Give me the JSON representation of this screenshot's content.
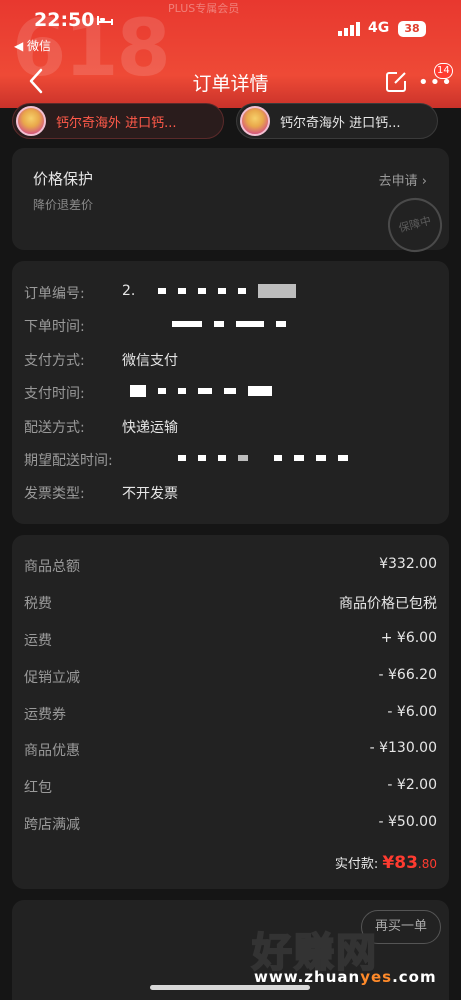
{
  "status_bar": {
    "time": "22:50",
    "back_app": "◀ 微信",
    "network": "4G",
    "battery": "38"
  },
  "header": {
    "background_text": "618",
    "faded_top_text": "PLUS专属会员",
    "title": "订单详情",
    "more_badge": "14"
  },
  "products": [
    {
      "name": "钙尔奇海外 进口钙..."
    },
    {
      "name": "钙尔奇海外 进口钙..."
    }
  ],
  "price_protection": {
    "title": "价格保护",
    "subtitle": "降价退差价",
    "link": "去申请 ›",
    "stamp": "保障中"
  },
  "order_info": {
    "order_no_label": "订单编号:",
    "order_no_prefix": "2.",
    "order_time_label": "下单时间:",
    "payment_method_label": "支付方式:",
    "payment_method": "微信支付",
    "payment_time_label": "支付时间:",
    "delivery_method_label": "配送方式:",
    "delivery_method": "快递运输",
    "expected_delivery_label": "期望配送时间:",
    "invoice_label": "发票类型:",
    "invoice_type": "不开发票"
  },
  "totals": [
    {
      "label": "商品总额",
      "value": "¥332.00"
    },
    {
      "label": "税费",
      "value": "商品价格已包税"
    },
    {
      "label": "运费",
      "value": "+ ¥6.00"
    },
    {
      "label": "促销立减",
      "value": "- ¥66.20"
    },
    {
      "label": "运费券",
      "value": "- ¥6.00"
    },
    {
      "label": "商品优惠",
      "value": "- ¥130.00"
    },
    {
      "label": "红包",
      "value": "- ¥2.00"
    },
    {
      "label": "跨店满减",
      "value": "- ¥50.00"
    }
  ],
  "paid": {
    "label": "实付款:",
    "amount": "¥83",
    "decimal": ".80"
  },
  "bottom": {
    "pill": "再买一单"
  },
  "watermark": {
    "cn": "好赚网",
    "url_a": "www.zhuan",
    "url_b": "yes",
    "url_c": ".com"
  },
  "colors": {
    "header_red": "#ee4a36",
    "price_red": "#ff3b30",
    "card_bg": "#222222",
    "page_bg": "#151515"
  }
}
